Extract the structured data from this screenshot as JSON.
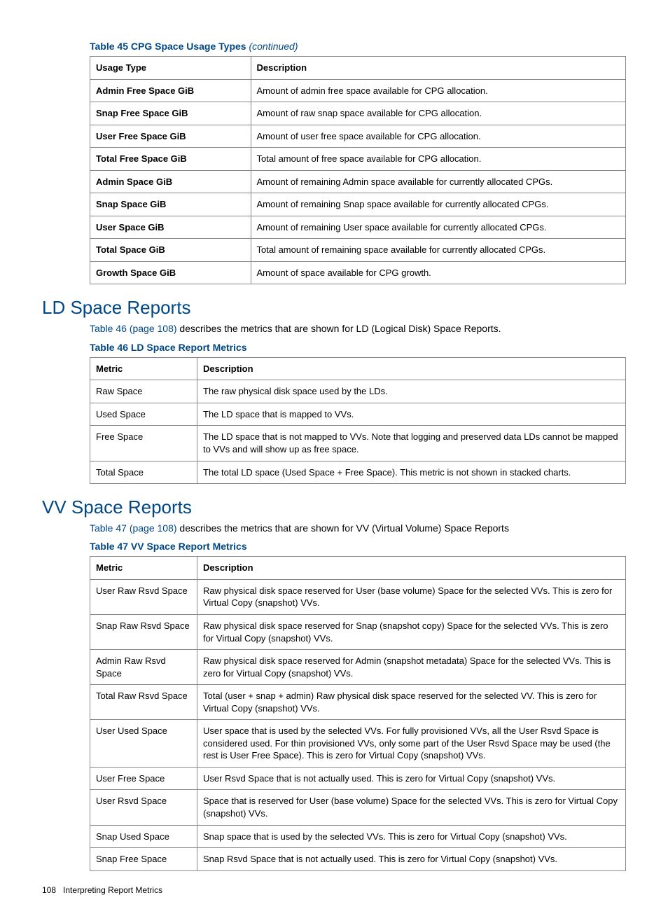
{
  "table45": {
    "caption_prefix": "Table 45 CPG Space Usage Types ",
    "caption_suffix": "(continued)",
    "headers": [
      "Usage Type",
      "Description"
    ],
    "rows": [
      [
        "Admin Free Space GiB",
        "Amount of admin free space available for CPG allocation."
      ],
      [
        "Snap Free Space GiB",
        "Amount of raw snap space available for CPG allocation."
      ],
      [
        "User Free Space GiB",
        "Amount of user free space available for CPG allocation."
      ],
      [
        "Total Free Space GiB",
        "Total amount of free space available for CPG allocation."
      ],
      [
        "Admin Space GiB",
        "Amount of remaining Admin space available for currently allocated CPGs."
      ],
      [
        "Snap Space GiB",
        "Amount of remaining Snap space available for currently allocated CPGs."
      ],
      [
        "User Space GiB",
        "Amount of remaining User space available for currently allocated CPGs."
      ],
      [
        "Total Space GiB",
        "Total amount of remaining space available for currently allocated CPGs."
      ],
      [
        "Growth Space GiB",
        "Amount of space available for CPG growth."
      ]
    ]
  },
  "section_ld": {
    "heading": "LD Space Reports",
    "intro_link": "Table 46 (page 108)",
    "intro_rest": " describes the metrics that are shown for LD (Logical Disk) Space Reports."
  },
  "table46": {
    "caption": "Table 46 LD Space Report Metrics",
    "headers": [
      "Metric",
      "Description"
    ],
    "rows": [
      [
        "Raw Space",
        "The raw physical disk space used by the LDs."
      ],
      [
        "Used Space",
        "The LD space that is mapped to VVs."
      ],
      [
        "Free Space",
        "The LD space that is not mapped to VVs. Note that logging and preserved data LDs cannot be mapped to VVs and will show up as free space."
      ],
      [
        "Total Space",
        "The total LD space (Used Space + Free Space). This metric is not shown in stacked charts."
      ]
    ]
  },
  "section_vv": {
    "heading": "VV Space Reports",
    "intro_link": "Table 47 (page 108)",
    "intro_rest": " describes the metrics that are shown for VV (Virtual Volume) Space Reports"
  },
  "table47": {
    "caption": "Table 47 VV Space Report Metrics",
    "headers": [
      "Metric",
      "Description"
    ],
    "rows": [
      [
        "User Raw Rsvd Space",
        "Raw physical disk space reserved for User (base volume) Space for the selected VVs. This is zero for Virtual Copy (snapshot) VVs."
      ],
      [
        "Snap Raw Rsvd Space",
        "Raw physical disk space reserved for Snap (snapshot copy) Space for the selected VVs. This is zero for Virtual Copy (snapshot) VVs."
      ],
      [
        "Admin Raw Rsvd Space",
        "Raw physical disk space reserved for Admin (snapshot metadata) Space for the selected VVs. This is zero for Virtual Copy (snapshot) VVs."
      ],
      [
        "Total Raw Rsvd Space",
        "Total (user + snap + admin) Raw physical disk space reserved for the selected VV. This is zero for Virtual Copy (snapshot) VVs."
      ],
      [
        "User Used Space",
        "User space that is used by the selected VVs. For fully provisioned VVs, all the User Rsvd Space is considered used. For thin provisioned VVs, only some part of the User Rsvd Space may be used (the rest is User Free Space). This is zero for Virtual Copy (snapshot) VVs."
      ],
      [
        "User Free Space",
        "User Rsvd Space that is not actually used. This is zero for Virtual Copy (snapshot) VVs."
      ],
      [
        "User Rsvd Space",
        "Space that is reserved for User (base volume) Space for the selected VVs. This is zero for Virtual Copy (snapshot) VVs."
      ],
      [
        "Snap Used Space",
        "Snap space that is used by the selected VVs. This is zero for Virtual Copy (snapshot) VVs."
      ],
      [
        "Snap Free Space",
        "Snap Rsvd Space that is not actually used. This is zero for Virtual Copy (snapshot) VVs."
      ]
    ]
  },
  "footer": {
    "page_number": "108",
    "label": "Interpreting Report Metrics"
  }
}
